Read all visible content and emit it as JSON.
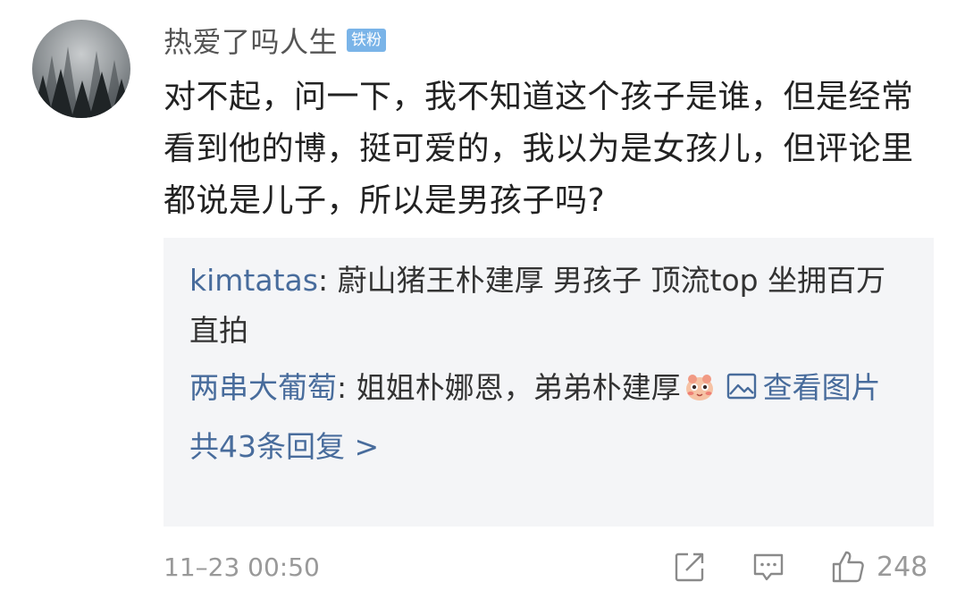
{
  "comment": {
    "username": "热爱了吗人生",
    "badge": "铁粉",
    "text": "对不起，问一下，我不知道这个孩子是谁，但是经常看到他的博，挺可爱的，我以为是女孩儿，但评论里都说是儿子，所以是男孩子吗?",
    "timestamp": "11–23 00:50",
    "like_count": "248"
  },
  "replies": [
    {
      "author": "kimtatas",
      "separator": ": ",
      "text": "蔚山猪王朴建厚 男孩子 顶流top 坐拥百万直拍"
    },
    {
      "author": "两串大葡萄",
      "separator": ": ",
      "text": "姐姐朴娜恩，弟弟朴建厚",
      "emoji": "cute-blush-emoji",
      "link": "查看图片"
    }
  ],
  "more_replies_label": "共43条回复 >",
  "icons": [
    "share-icon",
    "comment-icon",
    "like-icon",
    "image-icon"
  ],
  "colors": {
    "link": "#486c9c",
    "badge": "#7ab4e8",
    "reply_bg": "#f4f5f7",
    "muted": "#999999"
  }
}
